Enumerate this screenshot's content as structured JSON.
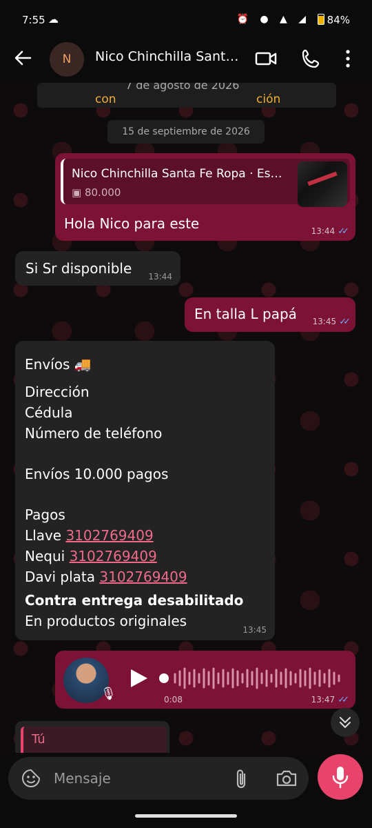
{
  "status_bar": {
    "time": "7:55",
    "battery": "84%"
  },
  "header": {
    "avatar_initial": "N",
    "contact_name": "Nico Chinchilla Santa Fe Ropa"
  },
  "partial_top": {
    "date_text": "7 de agosto de 2026",
    "banner_left": "con",
    "banner_right": "ción"
  },
  "date_chip": "15 de septiembre de 2026",
  "messages": [
    {
      "quote_title": "Nico Chinchilla Santa Fe Ropa · Es…",
      "quote_price": "80.000",
      "text": "Hola Nico para este",
      "time": "13:44"
    },
    {
      "text": "Si Sr disponible",
      "time": "13:44"
    },
    {
      "text": "En talla L papá",
      "time": "13:45"
    }
  ],
  "info_message": {
    "envios": "Envíos 🚚",
    "direccion": "Dirección",
    "cedula": "Cédula",
    "telefono": "Número de teléfono",
    "envios_pagos": "Envíos 10.000 pagos",
    "pagos": "Pagos",
    "llave_label": "Llave ",
    "nequi_label": "Nequi ",
    "davi_label": "Davi plata ",
    "number": "3102769409",
    "contra": "Contra entrega desabilitado",
    "originales": "En productos originales",
    "time": "13:45"
  },
  "voice_message": {
    "duration": "0:08",
    "time": "13:47"
  },
  "reply_preview": {
    "label": "Tú"
  },
  "composer": {
    "placeholder": "Mensaje"
  }
}
